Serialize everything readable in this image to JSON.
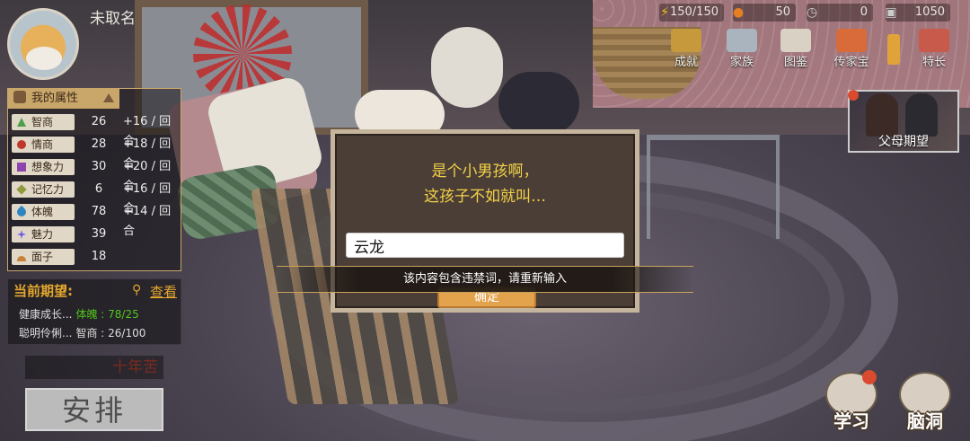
{
  "player": {
    "name": "未取名"
  },
  "resources": [
    {
      "icon": "lightning-icon",
      "value": "150/150"
    },
    {
      "icon": "bulb-icon",
      "value": "50"
    },
    {
      "icon": "clock-icon",
      "value": "0"
    },
    {
      "icon": "money-icon",
      "value": "1050"
    }
  ],
  "top_menu": [
    {
      "icon": "trophy-icon",
      "label": "成就"
    },
    {
      "icon": "family-icon",
      "label": "家族"
    },
    {
      "icon": "album-icon",
      "label": "图鉴"
    },
    {
      "icon": "treasure-icon",
      "label": "传家宝"
    },
    {
      "icon": "books-icon",
      "label": "特长"
    }
  ],
  "parents": {
    "label": "父母期望"
  },
  "attributes": {
    "title": "我的属性",
    "rows": [
      {
        "icon": "triangle-icon",
        "color": "#4aa14a",
        "name": "智商",
        "value": "26",
        "inc": "+16 / 回合"
      },
      {
        "icon": "circle-icon",
        "color": "#c0392b",
        "name": "情商",
        "value": "28",
        "inc": "+18 / 回合"
      },
      {
        "icon": "square-icon",
        "color": "#8e44ad",
        "name": "想象力",
        "value": "30",
        "inc": "+20 / 回合"
      },
      {
        "icon": "diamond-icon",
        "color": "#8f9a3a",
        "name": "记忆力",
        "value": "6",
        "inc": "+16 / 回合"
      },
      {
        "icon": "drop-icon",
        "color": "#2e86c1",
        "name": "体魄",
        "value": "78",
        "inc": "+14 / 回合"
      },
      {
        "icon": "star-icon",
        "color": "#6c5ce7",
        "name": "魅力",
        "value": "39",
        "inc": ""
      },
      {
        "icon": "semicircle-icon",
        "color": "#c6843a",
        "name": "面子",
        "value": "18",
        "inc": ""
      }
    ]
  },
  "expectations": {
    "title": "当前期望:",
    "view_label": "查看",
    "rows": [
      {
        "name": "健康成长...",
        "stat": "体魄 : 78/25",
        "color": "#52c41a"
      },
      {
        "name": "聪明伶俐...",
        "stat": "智商 : 26/100",
        "color": "#dddddd"
      }
    ]
  },
  "ten_year": "十年苦",
  "arrange_label": "安排",
  "bottom_buttons": [
    {
      "icon": "study-icon",
      "label": "学习"
    },
    {
      "icon": "brainstorm-icon",
      "label": "脑洞"
    }
  ],
  "dialog": {
    "line1": "是个小男孩啊，",
    "line2": "这孩子不如就叫…",
    "input_value": "云龙",
    "confirm_label": "确定"
  },
  "toast": "该内容包含违禁词，请重新输入"
}
